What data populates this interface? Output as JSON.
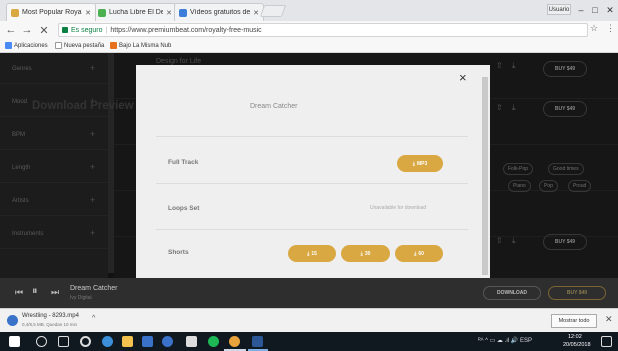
{
  "browser": {
    "tabs": [
      {
        "title": "Most Popular Royalty Fr",
        "favicon_color": "#d9a843",
        "active": true
      },
      {
        "title": "Lucha Libre El Deporte",
        "favicon_color": "#4caf50",
        "active": false
      },
      {
        "title": "Vídeos gratuitos de Yen",
        "favicon_color": "#3b7dd8",
        "active": false
      }
    ],
    "user_badge": "Usuario",
    "window": {
      "minimize": "–",
      "maximize": "□",
      "close": "✕"
    },
    "nav": {
      "back": "←",
      "forward": "→",
      "reload": "✕"
    },
    "address": {
      "secure_label": "Es seguro",
      "separator": "|",
      "url": "https://www.premiumbeat.com/royalty-free-music"
    },
    "star": "☆",
    "menu": "⋮",
    "bookmarks": [
      {
        "label": "Aplicaciones",
        "icon_color": "#4a8af4"
      },
      {
        "label": "Nueva pestaña",
        "icon_color": "#cccccc"
      },
      {
        "label": "Bajo La Misma Nub",
        "icon_color": "#e8711c"
      }
    ]
  },
  "sidebar": {
    "filters": [
      "Genres",
      "Mood",
      "BPM",
      "Length",
      "Artists",
      "Instruments"
    ],
    "plus": "+"
  },
  "background": {
    "visible_title": "Design for Life",
    "buy_label": "BUY $49",
    "tags": [
      "Folk-Pop",
      "Good times",
      "Piano",
      "Pop",
      "Proud"
    ],
    "icons": {
      "share": "⇧",
      "download": "⤓"
    }
  },
  "modal": {
    "close": "×",
    "title": "Download Preview",
    "track": "Dream Catcher",
    "rows": [
      {
        "label": "Full Track"
      },
      {
        "label": "Loops Set"
      },
      {
        "label": "Shorts"
      }
    ],
    "mp3_button": "MP3",
    "download_glyph": "⤓",
    "unavailable": "Unavailable for download",
    "shorts_buttons": [
      "15",
      "30",
      "60"
    ]
  },
  "player": {
    "prev": "⏮",
    "pause": "⏸",
    "next": "⏭",
    "title": "Dream Catcher",
    "artist": "Ivy Digital",
    "download": "DOWNLOAD",
    "buy": "BUY $49"
  },
  "download_shelf": {
    "file": "Wrestling - 8293.mp4",
    "status": "0,4/8,5 MB, Quedan 10 min",
    "caret": "^",
    "show_all": "Mostrar todo",
    "close": "✕"
  },
  "taskbar": {
    "apps": [
      {
        "name": "windows-start",
        "color": "#ffffff"
      },
      {
        "name": "search",
        "color": "#dddddd"
      },
      {
        "name": "task-view",
        "color": "#dddddd"
      },
      {
        "name": "cortana",
        "color": "#dddddd"
      },
      {
        "name": "edge",
        "color": "#3b8fd9"
      },
      {
        "name": "file-explorer",
        "color": "#f2c14e"
      },
      {
        "name": "store",
        "color": "#3a72c9"
      },
      {
        "name": "chrome-like",
        "color": "#3a72c9"
      },
      {
        "name": "media",
        "color": "#dddddd"
      },
      {
        "name": "spotify",
        "color": "#1db954"
      },
      {
        "name": "chrome",
        "color": "#e8a33a"
      },
      {
        "name": "word",
        "color": "#2b5797"
      }
    ],
    "tray": "ᴿᴬ ^ ▭ ☁ .ıl 🔊 ESP",
    "time": "12:02",
    "date": "20/05/2018"
  }
}
